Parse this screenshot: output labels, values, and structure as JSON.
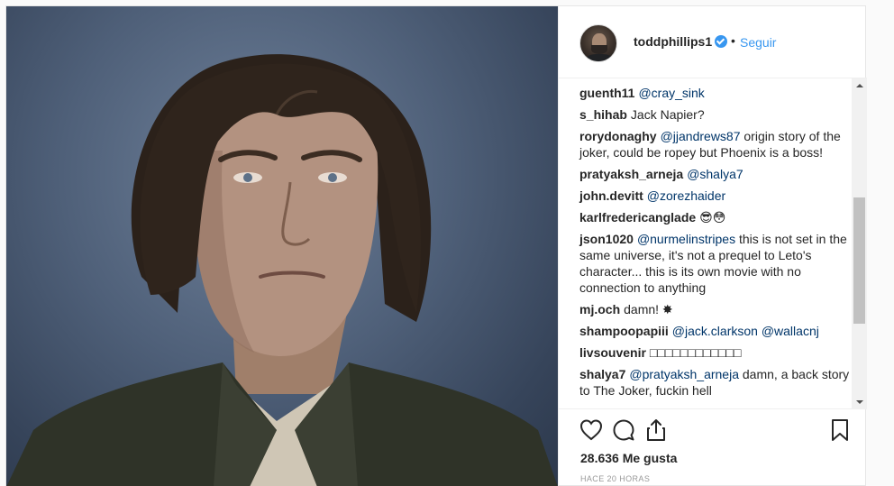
{
  "post": {
    "author": {
      "username": "toddphillips1",
      "separator": "•",
      "follow_label": "Seguir"
    },
    "comments": [
      {
        "user": "guenth11",
        "parts": [
          {
            "t": "@cray_sink",
            "m": true
          }
        ]
      },
      {
        "user": "s_hihab",
        "parts": [
          {
            "t": "Jack Napier?",
            "m": false
          }
        ]
      },
      {
        "user": "rorydonaghy",
        "parts": [
          {
            "t": "@jjandrews87",
            "m": true
          },
          {
            "t": " origin story of the joker, could be ropey but Phoenix is a boss!",
            "m": false
          }
        ]
      },
      {
        "user": "pratyaksh_arneja",
        "parts": [
          {
            "t": "@shalya7",
            "m": true
          }
        ]
      },
      {
        "user": "john.devitt",
        "parts": [
          {
            "t": "@zorezhaider",
            "m": true
          }
        ]
      },
      {
        "user": "karlfredericanglade",
        "parts": [
          {
            "t": "😎😳",
            "m": false
          }
        ]
      },
      {
        "user": "json1020",
        "parts": [
          {
            "t": "@nurmelinstripes",
            "m": true
          },
          {
            "t": " this is not set in the same universe, it's not a prequel to Leto's character... this is its own movie with no connection to anything",
            "m": false
          }
        ]
      },
      {
        "user": "mj.och",
        "parts": [
          {
            "t": "damn! ✸",
            "m": false
          }
        ]
      },
      {
        "user": "shampoopapiii",
        "parts": [
          {
            "t": "@jack.clarkson",
            "m": true
          },
          {
            "t": " ",
            "m": false
          },
          {
            "t": "@wallacnj",
            "m": true
          }
        ]
      },
      {
        "user": "livsouvenir",
        "parts": [
          {
            "t": "□□□□□□□□□□□□",
            "m": false
          }
        ]
      },
      {
        "user": "shalya7",
        "parts": [
          {
            "t": "@pratyaksh_arneja",
            "m": true
          },
          {
            "t": " damn, a back story to The Joker, fuckin hell",
            "m": false
          }
        ]
      }
    ],
    "likes": "28.636 Me gusta",
    "timestamp": "HACE 20 HORAS",
    "icons": {
      "like": "heart-icon",
      "comment": "comment-icon",
      "share": "share-icon",
      "save": "bookmark-icon",
      "verified": "verified-badge-icon"
    },
    "colors": {
      "link": "#3897f0",
      "mention": "#003569",
      "text": "#262626",
      "muted": "#999999"
    }
  }
}
